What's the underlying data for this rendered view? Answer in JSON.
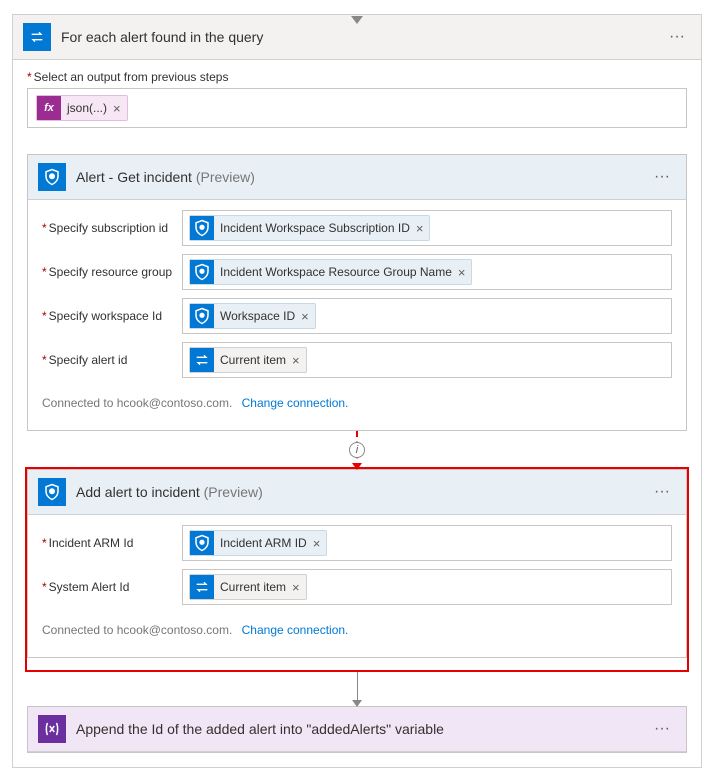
{
  "foreach": {
    "title": "For each alert found in the query",
    "output_label": "Select an output from previous steps",
    "json_token": "json(...)"
  },
  "getIncident": {
    "title": "Alert - Get incident",
    "preview": "(Preview)",
    "fields": {
      "sub_label": "Specify subscription id",
      "sub_value": "Incident Workspace Subscription ID",
      "rg_label": "Specify resource group",
      "rg_value": "Incident Workspace Resource Group Name",
      "ws_label": "Specify workspace Id",
      "ws_value": "Workspace ID",
      "alert_label": "Specify alert id",
      "alert_value": "Current item"
    },
    "connected": "Connected to hcook@contoso.com.",
    "change": "Change connection."
  },
  "addAlert": {
    "title": "Add alert to incident",
    "preview": "(Preview)",
    "fields": {
      "arm_label": "Incident ARM Id",
      "arm_value": "Incident ARM ID",
      "sys_label": "System Alert Id",
      "sys_value": "Current item"
    },
    "connected": "Connected to hcook@contoso.com.",
    "change": "Change connection."
  },
  "append": {
    "title": "Append the Id of the added alert into \"addedAlerts\" variable"
  },
  "icons": {
    "x": "×",
    "menu": "···",
    "info": "i"
  }
}
